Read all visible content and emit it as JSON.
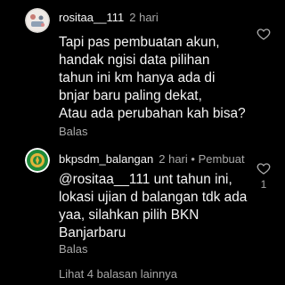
{
  "comments": [
    {
      "username": "rositaa__111",
      "time": "2 hari",
      "lines": [
        "Tapi pas pembuatan akun,",
        "handak ngisi data pilihan",
        "tahun ini km hanya ada di",
        "bnjar baru paling dekat,",
        "Atau ada perubahan kah bisa?"
      ],
      "reply_label": "Balas",
      "like_icon": "heart-outline-icon"
    },
    {
      "username": "bkpsdm_balangan",
      "time": "2 hari",
      "separator": "•",
      "author_label": "Pembuat",
      "lines": [
        "@rositaa__111 unt tahun ini,",
        "lokasi ujian d balangan tdk ada",
        "yaa, silahkan pilih BKN",
        "Banjarbaru"
      ],
      "reply_label": "Balas",
      "like_icon": "heart-outline-icon",
      "like_count": "1"
    }
  ],
  "more_replies_label": "Lihat 4 balasan lainnya",
  "colors": {
    "background": "#000000",
    "text": "#f5f5f5",
    "muted": "#a8a8a8",
    "avatar_green": "#1f8a3a",
    "avatar_gold": "#e2b43b"
  }
}
